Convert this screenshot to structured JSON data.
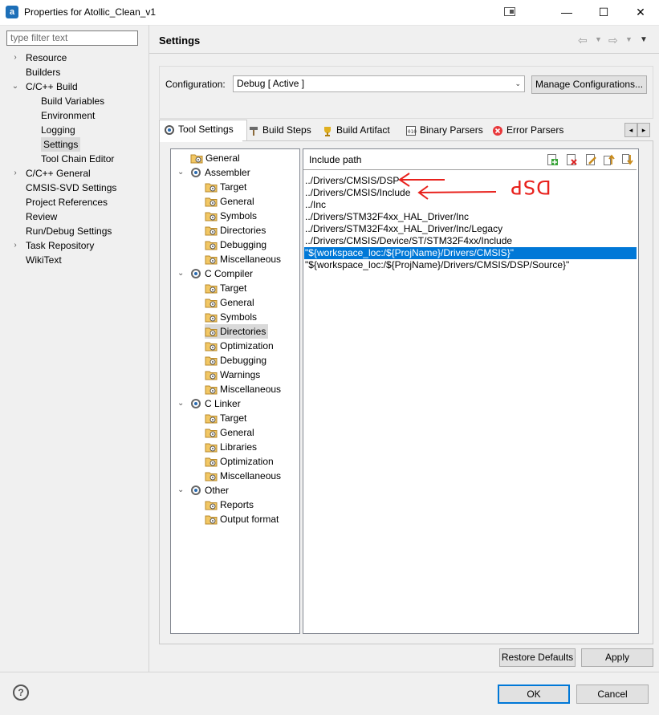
{
  "window": {
    "title": "Properties for Atollic_Clean_v1",
    "app_icon_letter": "a",
    "controls": {
      "minimize": "—",
      "maximize": "☐",
      "close": "✕"
    }
  },
  "filter": {
    "placeholder": "type filter text"
  },
  "nav": [
    {
      "label": "Resource",
      "arrow": "›"
    },
    {
      "label": "Builders",
      "arrow": ""
    },
    {
      "label": "C/C++ Build",
      "arrow": "⌄"
    },
    {
      "label": "Build Variables",
      "arrow": ""
    },
    {
      "label": "Environment",
      "arrow": ""
    },
    {
      "label": "Logging",
      "arrow": ""
    },
    {
      "label": "Settings",
      "arrow": ""
    },
    {
      "label": "Tool Chain Editor",
      "arrow": ""
    },
    {
      "label": "C/C++ General",
      "arrow": "›"
    },
    {
      "label": "CMSIS-SVD Settings",
      "arrow": ""
    },
    {
      "label": "Project References",
      "arrow": ""
    },
    {
      "label": "Review",
      "arrow": ""
    },
    {
      "label": "Run/Debug Settings",
      "arrow": ""
    },
    {
      "label": "Task Repository",
      "arrow": "›"
    },
    {
      "label": "WikiText",
      "arrow": ""
    }
  ],
  "page": {
    "title": "Settings",
    "config_label": "Configuration:",
    "config_value": "Debug  [ Active ]",
    "manage_button": "Manage Configurations..."
  },
  "tabs": [
    {
      "label": "Tool Settings"
    },
    {
      "label": "Build Steps"
    },
    {
      "label": "Build Artifact"
    },
    {
      "label": "Binary Parsers"
    },
    {
      "label": "Error Parsers"
    }
  ],
  "tree": [
    {
      "label": "General",
      "arrow": "",
      "icon": "folder-settings-icon"
    },
    {
      "label": "Assembler",
      "arrow": "⌄",
      "icon": "gear-icon"
    },
    {
      "label": "Target",
      "arrow": "",
      "icon": "folder-settings-icon"
    },
    {
      "label": "General",
      "arrow": "",
      "icon": "folder-settings-icon"
    },
    {
      "label": "Symbols",
      "arrow": "",
      "icon": "folder-settings-icon"
    },
    {
      "label": "Directories",
      "arrow": "",
      "icon": "folder-settings-icon"
    },
    {
      "label": "Debugging",
      "arrow": "",
      "icon": "folder-settings-icon"
    },
    {
      "label": "Miscellaneous",
      "arrow": "",
      "icon": "folder-settings-icon"
    },
    {
      "label": "C Compiler",
      "arrow": "⌄",
      "icon": "gear-icon"
    },
    {
      "label": "Target",
      "arrow": "",
      "icon": "folder-settings-icon"
    },
    {
      "label": "General",
      "arrow": "",
      "icon": "folder-settings-icon"
    },
    {
      "label": "Symbols",
      "arrow": "",
      "icon": "folder-settings-icon"
    },
    {
      "label": "Directories",
      "arrow": "",
      "icon": "folder-settings-icon"
    },
    {
      "label": "Optimization",
      "arrow": "",
      "icon": "folder-settings-icon"
    },
    {
      "label": "Debugging",
      "arrow": "",
      "icon": "folder-settings-icon"
    },
    {
      "label": "Warnings",
      "arrow": "",
      "icon": "folder-settings-icon"
    },
    {
      "label": "Miscellaneous",
      "arrow": "",
      "icon": "folder-settings-icon"
    },
    {
      "label": "C Linker",
      "arrow": "⌄",
      "icon": "gear-icon"
    },
    {
      "label": "Target",
      "arrow": "",
      "icon": "folder-settings-icon"
    },
    {
      "label": "General",
      "arrow": "",
      "icon": "folder-settings-icon"
    },
    {
      "label": "Libraries",
      "arrow": "",
      "icon": "folder-settings-icon"
    },
    {
      "label": "Optimization",
      "arrow": "",
      "icon": "folder-settings-icon"
    },
    {
      "label": "Miscellaneous",
      "arrow": "",
      "icon": "folder-settings-icon"
    },
    {
      "label": "Other",
      "arrow": "⌄",
      "icon": "gear-icon"
    },
    {
      "label": "Reports",
      "arrow": "",
      "icon": "folder-settings-icon"
    },
    {
      "label": "Output format",
      "arrow": "",
      "icon": "folder-settings-icon"
    }
  ],
  "include": {
    "header": "Include path",
    "paths": [
      "../Drivers/CMSIS/DSP",
      "../Drivers/CMSIS/Include",
      "../Inc",
      "../Drivers/STM32F4xx_HAL_Driver/Inc",
      "../Drivers/STM32F4xx_HAL_Driver/Inc/Legacy",
      "../Drivers/CMSIS/Device/ST/STM32F4xx/Include",
      "\"${workspace_loc:/${ProjName}/Drivers/CMSIS}\"",
      "\"${workspace_loc:/${ProjName}/Drivers/CMSIS/DSP/Source}\""
    ],
    "selected_index": 6,
    "tools": [
      "add-icon",
      "delete-icon",
      "edit-icon",
      "move-up-icon",
      "move-down-icon"
    ]
  },
  "annotation": {
    "handwritten_text": "DSP",
    "color": "#e8211c"
  },
  "buttons": {
    "restore": "Restore Defaults",
    "apply": "Apply",
    "ok": "OK",
    "cancel": "Cancel",
    "help": "?"
  },
  "colors": {
    "selection": "#0078d7",
    "annotation": "#e8211c"
  }
}
